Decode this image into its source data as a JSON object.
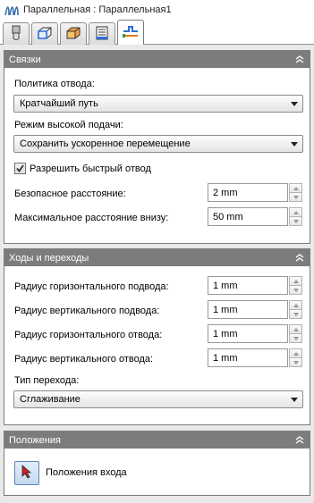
{
  "window": {
    "title": "Параллельная : Параллельная1"
  },
  "tabs": [
    {
      "name": "tool"
    },
    {
      "name": "edges"
    },
    {
      "name": "stock"
    },
    {
      "name": "passes"
    },
    {
      "name": "linking"
    }
  ],
  "links_panel": {
    "header": "Связки",
    "retract_policy_label": "Политика отвода:",
    "retract_policy_value": "Кратчайший путь",
    "high_feed_label": "Режим высокой подачи:",
    "high_feed_value": "Сохранить ускоренное перемещение",
    "fast_retract_label": "Разрешить быстрый отвод",
    "fast_retract_checked": true,
    "safe_distance_label": "Безопасное расстояние:",
    "safe_distance_value": "2 mm",
    "max_down_label": "Максимальное расстояние внизу:",
    "max_down_value": "50 mm"
  },
  "leads_panel": {
    "header": "Ходы и переходы",
    "h_lead_in_label": "Радиус горизонтального подвода:",
    "h_lead_in_value": "1 mm",
    "v_lead_in_label": "Радиус вертикального подвода:",
    "v_lead_in_value": "1 mm",
    "h_lead_out_label": "Радиус горизонтального отвода:",
    "h_lead_out_value": "1 mm",
    "v_lead_out_label": "Радиус вертикального отвода:",
    "v_lead_out_value": "1 mm",
    "transition_label": "Тип перехода:",
    "transition_value": "Сглаживание"
  },
  "positions_panel": {
    "header": "Положения",
    "entry_label": "Положения входа"
  }
}
